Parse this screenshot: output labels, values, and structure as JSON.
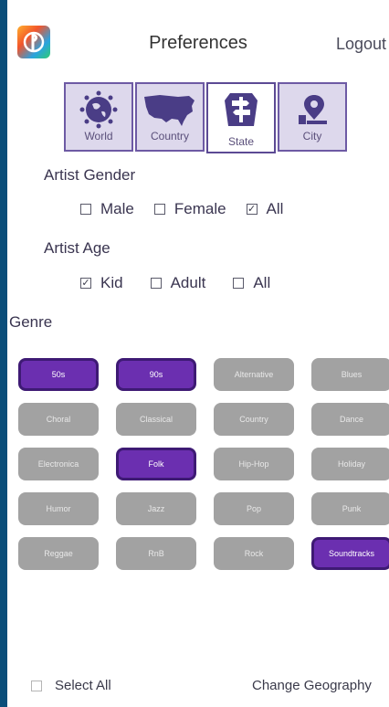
{
  "header": {
    "title": "Preferences",
    "logout_label": "Logout"
  },
  "geography": [
    {
      "label": "World",
      "icon": "globe-icon",
      "selected": false
    },
    {
      "label": "Country",
      "icon": "usa-map-icon",
      "selected": false
    },
    {
      "label": "State",
      "icon": "signpost-icon",
      "selected": true
    },
    {
      "label": "City",
      "icon": "city-pin-icon",
      "selected": false
    }
  ],
  "artist_gender": {
    "label": "Artist Gender",
    "options": [
      {
        "label": "Male",
        "checked": false
      },
      {
        "label": "Female",
        "checked": false
      },
      {
        "label": "All",
        "checked": true
      }
    ]
  },
  "artist_age": {
    "label": "Artist Age",
    "options": [
      {
        "label": "Kid",
        "checked": true
      },
      {
        "label": "Adult",
        "checked": false
      },
      {
        "label": "All",
        "checked": false
      }
    ]
  },
  "genre": {
    "label": "Genre",
    "items": [
      {
        "label": "50s",
        "selected": true
      },
      {
        "label": "90s",
        "selected": true
      },
      {
        "label": "Alternative",
        "selected": false
      },
      {
        "label": "Blues",
        "selected": false
      },
      {
        "label": "Choral",
        "selected": false
      },
      {
        "label": "Classical",
        "selected": false
      },
      {
        "label": "Country",
        "selected": false
      },
      {
        "label": "Dance",
        "selected": false
      },
      {
        "label": "Electronica",
        "selected": false
      },
      {
        "label": "Folk",
        "selected": true
      },
      {
        "label": "Hip-Hop",
        "selected": false
      },
      {
        "label": "Holiday",
        "selected": false
      },
      {
        "label": "Humor",
        "selected": false
      },
      {
        "label": "Jazz",
        "selected": false
      },
      {
        "label": "Pop",
        "selected": false
      },
      {
        "label": "Punk",
        "selected": false
      },
      {
        "label": "Reggae",
        "selected": false
      },
      {
        "label": "RnB",
        "selected": false
      },
      {
        "label": "Rock",
        "selected": false
      },
      {
        "label": "Soundtracks",
        "selected": true
      }
    ]
  },
  "footer": {
    "select_all_label": "Select All",
    "select_all_checked": false,
    "change_geography_label": "Change Geography"
  },
  "colors": {
    "background": "#0b4e7a",
    "accent": "#6b2fb0",
    "chip_off": "#a2a2a2",
    "tile_bg": "#ddd8ec"
  }
}
